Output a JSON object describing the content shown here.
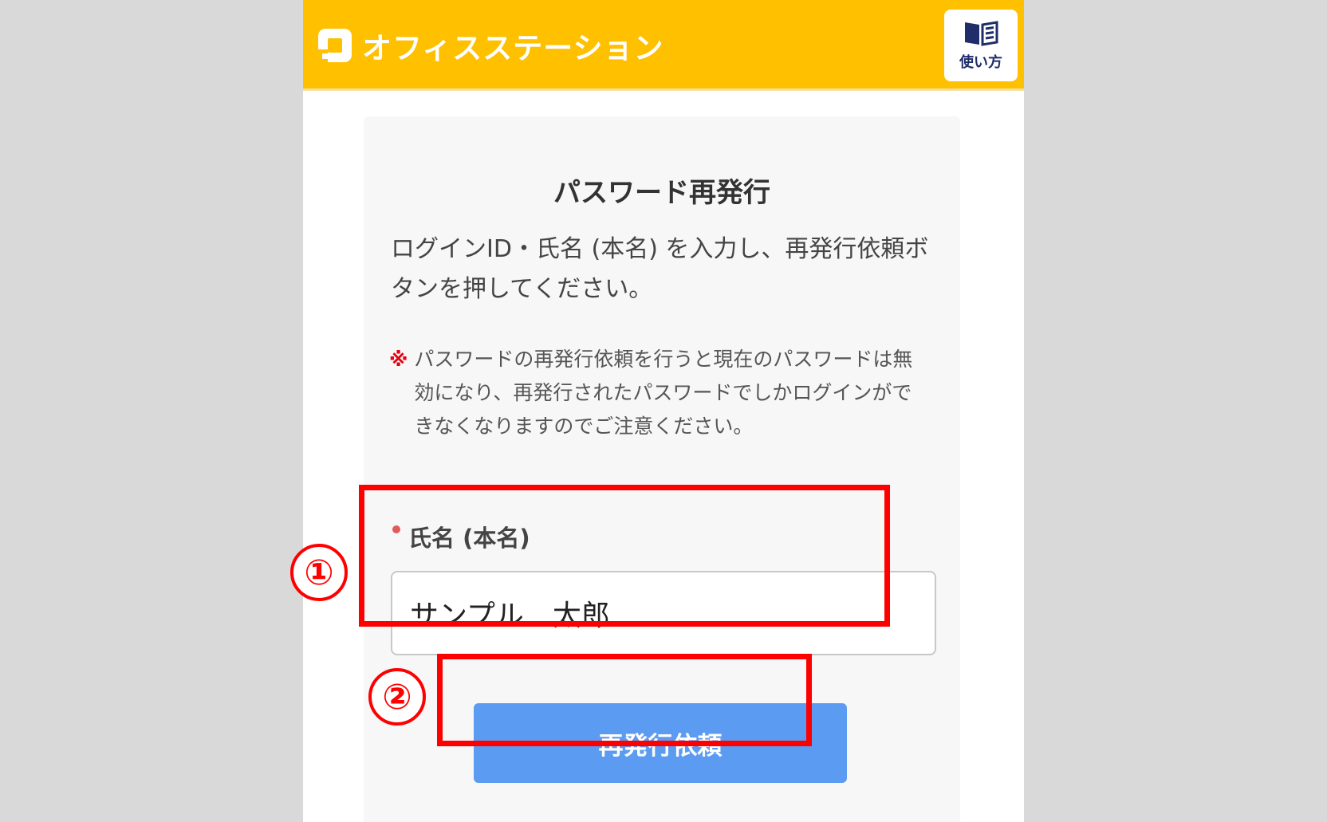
{
  "header": {
    "logo_text": "オフィスステーション",
    "guide_label": "使い方",
    "guide_icon": "book-icon",
    "background_color": "#ffc000"
  },
  "page": {
    "title": "パスワード再発行",
    "intro": "ログインID・氏名 (本名) を入力し、再発行依頼ボタンを押してください。",
    "note_mark": "※",
    "note": "パスワードの再発行依頼を行うと現在のパスワードは無効になり、再発行されたパスワードでしかログインができなくなりますのでご注意ください。"
  },
  "form": {
    "name_label": "氏名 (本名)",
    "name_value": "サンプル　太郎",
    "required": true
  },
  "actions": {
    "submit_label": "再発行依頼",
    "submit_color": "#5b9cf2"
  },
  "annotations": {
    "step1": "①",
    "step2": "②",
    "highlight_color": "#ff0000"
  }
}
